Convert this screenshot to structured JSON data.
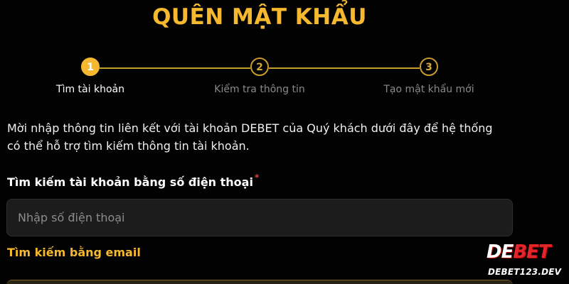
{
  "page": {
    "title": "QUÊN MẬT KHẨU",
    "accent_color": "#f5b82e"
  },
  "stepper": {
    "steps": [
      {
        "number": "1",
        "label": "Tìm tài khoản",
        "state": "active"
      },
      {
        "number": "2",
        "label": "Kiểm tra thông tin",
        "state": "inactive"
      },
      {
        "number": "3",
        "label": "Tạo mật khẩu mới",
        "state": "inactive"
      }
    ]
  },
  "form": {
    "description": "Mời nhập thông tin liên kết với tài khoản DEBET của Quý khách dưới đây để hệ thống có thể hỗ trợ tìm kiếm thông tin tài khoản.",
    "phone_label": "Tìm kiếm tài khoản bằng số điện thoại",
    "required_marker": "*",
    "phone_placeholder": "Nhập số điện thoại",
    "phone_value": "",
    "email_link": "Tìm kiếm bằng email"
  },
  "logo": {
    "brand_main_left": "DE",
    "brand_main_right": "BET",
    "brand_sub": "DEBET123.DEV"
  }
}
